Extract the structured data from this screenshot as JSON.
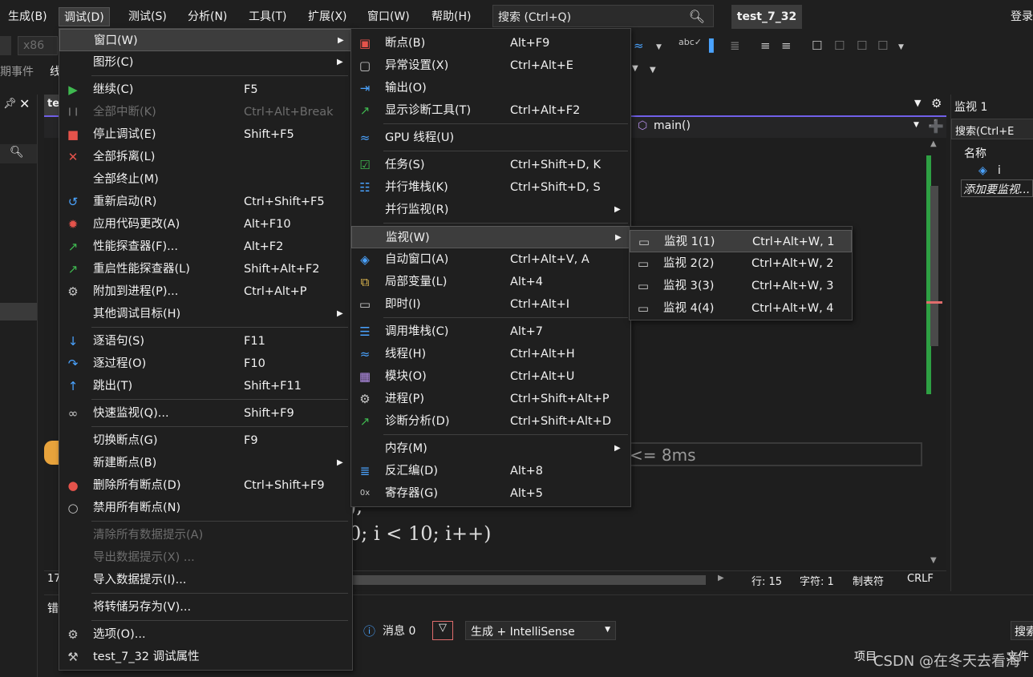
{
  "menubar": {
    "items": [
      "生成(B)",
      "调试(D)",
      "测试(S)",
      "分析(N)",
      "工具(T)",
      "扩展(X)",
      "窗口(W)",
      "帮助(H)"
    ],
    "search_text": "搜索 (Ctrl+Q)",
    "solution": "test_7_32",
    "login": "登录"
  },
  "toolbar": {
    "platform": "x86",
    "events_label": "期事件",
    "events_label2": "线"
  },
  "editor": {
    "tab_label": "tes",
    "nav_function": "main()",
    "perf_tip": "<= 8ms",
    "code_line1": ");",
    "code_line2": "0;  i  <  10;  i++)",
    "line_num": "17",
    "status": {
      "row": "行: 15",
      "col": "字符: 1",
      "tab": "制表符",
      "eol": "CRLF"
    }
  },
  "watch": {
    "title": "监视 1",
    "search": "搜索(Ctrl+E",
    "col_name": "名称",
    "item": "i",
    "add_hint": "添加要监视..."
  },
  "bottom": {
    "title": "错",
    "messages": "消息 0",
    "build_filter": "生成 + IntelliSense",
    "project_col": "项目",
    "file_col": "文件",
    "search": "搜索"
  },
  "menu_debug": {
    "items": [
      {
        "label": "窗口(W)",
        "shortcut": "",
        "icon": "",
        "submenu": true,
        "highlighted": true
      },
      {
        "label": "图形(C)",
        "shortcut": "",
        "icon": "",
        "submenu": true
      },
      {
        "label": "继续(C)",
        "shortcut": "F5",
        "icon": "play-icon"
      },
      {
        "label": "全部中断(K)",
        "shortcut": "Ctrl+Alt+Break",
        "icon": "pause-icon",
        "disabled": true
      },
      {
        "label": "停止调试(E)",
        "shortcut": "Shift+F5",
        "icon": "stop-icon"
      },
      {
        "label": "全部拆离(L)",
        "shortcut": "",
        "icon": "detach-icon"
      },
      {
        "label": "全部终止(M)",
        "shortcut": "",
        "icon": ""
      },
      {
        "label": "重新启动(R)",
        "shortcut": "Ctrl+Shift+F5",
        "icon": "restart-icon"
      },
      {
        "label": "应用代码更改(A)",
        "shortcut": "Alt+F10",
        "icon": "hot-reload-icon"
      },
      {
        "label": "性能探查器(F)...",
        "shortcut": "Alt+F2",
        "icon": "profiler-icon"
      },
      {
        "label": "重启性能探查器(L)",
        "shortcut": "Shift+Alt+F2",
        "icon": "profiler-restart-icon"
      },
      {
        "label": "附加到进程(P)...",
        "shortcut": "Ctrl+Alt+P",
        "icon": "attach-icon"
      },
      {
        "label": "其他调试目标(H)",
        "shortcut": "",
        "icon": "",
        "submenu": true
      },
      {
        "label": "逐语句(S)",
        "shortcut": "F11",
        "icon": "step-into-icon"
      },
      {
        "label": "逐过程(O)",
        "shortcut": "F10",
        "icon": "step-over-icon"
      },
      {
        "label": "跳出(T)",
        "shortcut": "Shift+F11",
        "icon": "step-out-icon"
      },
      {
        "label": "快速监视(Q)...",
        "shortcut": "Shift+F9",
        "icon": "glasses-icon"
      },
      {
        "label": "切换断点(G)",
        "shortcut": "F9",
        "icon": ""
      },
      {
        "label": "新建断点(B)",
        "shortcut": "",
        "icon": "",
        "submenu": true
      },
      {
        "label": "删除所有断点(D)",
        "shortcut": "Ctrl+Shift+F9",
        "icon": "delete-breakpoints-icon"
      },
      {
        "label": "禁用所有断点(N)",
        "shortcut": "",
        "icon": "disable-breakpoints-icon"
      },
      {
        "label": "清除所有数据提示(A)",
        "shortcut": "",
        "icon": "",
        "disabled": true
      },
      {
        "label": "导出数据提示(X) ...",
        "shortcut": "",
        "icon": "",
        "disabled": true
      },
      {
        "label": "导入数据提示(I)...",
        "shortcut": "",
        "icon": ""
      },
      {
        "label": "将转储另存为(V)...",
        "shortcut": "",
        "icon": ""
      },
      {
        "label": "选项(O)...",
        "shortcut": "",
        "icon": "gear-icon"
      },
      {
        "label": "test_7_32 调试属性",
        "shortcut": "",
        "icon": "wrench-icon"
      }
    ]
  },
  "menu_window": {
    "items": [
      {
        "label": "断点(B)",
        "shortcut": "Alt+F9",
        "icon": "breakpoints-icon"
      },
      {
        "label": "异常设置(X)",
        "shortcut": "Ctrl+Alt+E",
        "icon": "exception-icon"
      },
      {
        "label": "输出(O)",
        "shortcut": "",
        "icon": "output-icon"
      },
      {
        "label": "显示诊断工具(T)",
        "shortcut": "Ctrl+Alt+F2",
        "icon": "diagnostics-icon"
      },
      {
        "label": "GPU 线程(U)",
        "shortcut": "",
        "icon": "gpu-threads-icon"
      },
      {
        "label": "任务(S)",
        "shortcut": "Ctrl+Shift+D, K",
        "icon": "tasks-icon"
      },
      {
        "label": "并行堆栈(K)",
        "shortcut": "Ctrl+Shift+D, S",
        "icon": "parallel-stacks-icon"
      },
      {
        "label": "并行监视(R)",
        "shortcut": "",
        "icon": "",
        "submenu": true
      },
      {
        "label": "监视(W)",
        "shortcut": "",
        "icon": "",
        "submenu": true,
        "highlighted": true
      },
      {
        "label": "自动窗口(A)",
        "shortcut": "Ctrl+Alt+V, A",
        "icon": "autos-icon"
      },
      {
        "label": "局部变量(L)",
        "shortcut": "Alt+4",
        "icon": "locals-icon"
      },
      {
        "label": "即时(I)",
        "shortcut": "Ctrl+Alt+I",
        "icon": "immediate-icon"
      },
      {
        "label": "调用堆栈(C)",
        "shortcut": "Alt+7",
        "icon": "call-stack-icon"
      },
      {
        "label": "线程(H)",
        "shortcut": "Ctrl+Alt+H",
        "icon": "threads-icon"
      },
      {
        "label": "模块(O)",
        "shortcut": "Ctrl+Alt+U",
        "icon": "modules-icon"
      },
      {
        "label": "进程(P)",
        "shortcut": "Ctrl+Shift+Alt+P",
        "icon": "processes-icon"
      },
      {
        "label": "诊断分析(D)",
        "shortcut": "Ctrl+Shift+Alt+D",
        "icon": "diagnostic-analysis-icon"
      },
      {
        "label": "内存(M)",
        "shortcut": "",
        "icon": "",
        "submenu": true
      },
      {
        "label": "反汇编(D)",
        "shortcut": "Alt+8",
        "icon": "disassembly-icon"
      },
      {
        "label": "寄存器(G)",
        "shortcut": "Alt+5",
        "icon": "registers-icon"
      }
    ]
  },
  "menu_watch": {
    "items": [
      {
        "label": "监视 1(1)",
        "shortcut": "Ctrl+Alt+W, 1",
        "highlighted": true
      },
      {
        "label": "监视 2(2)",
        "shortcut": "Ctrl+Alt+W, 2"
      },
      {
        "label": "监视 3(3)",
        "shortcut": "Ctrl+Alt+W, 3"
      },
      {
        "label": "监视 4(4)",
        "shortcut": "Ctrl+Alt+W, 4"
      }
    ]
  },
  "watermark": "CSDN @在冬天去看海"
}
